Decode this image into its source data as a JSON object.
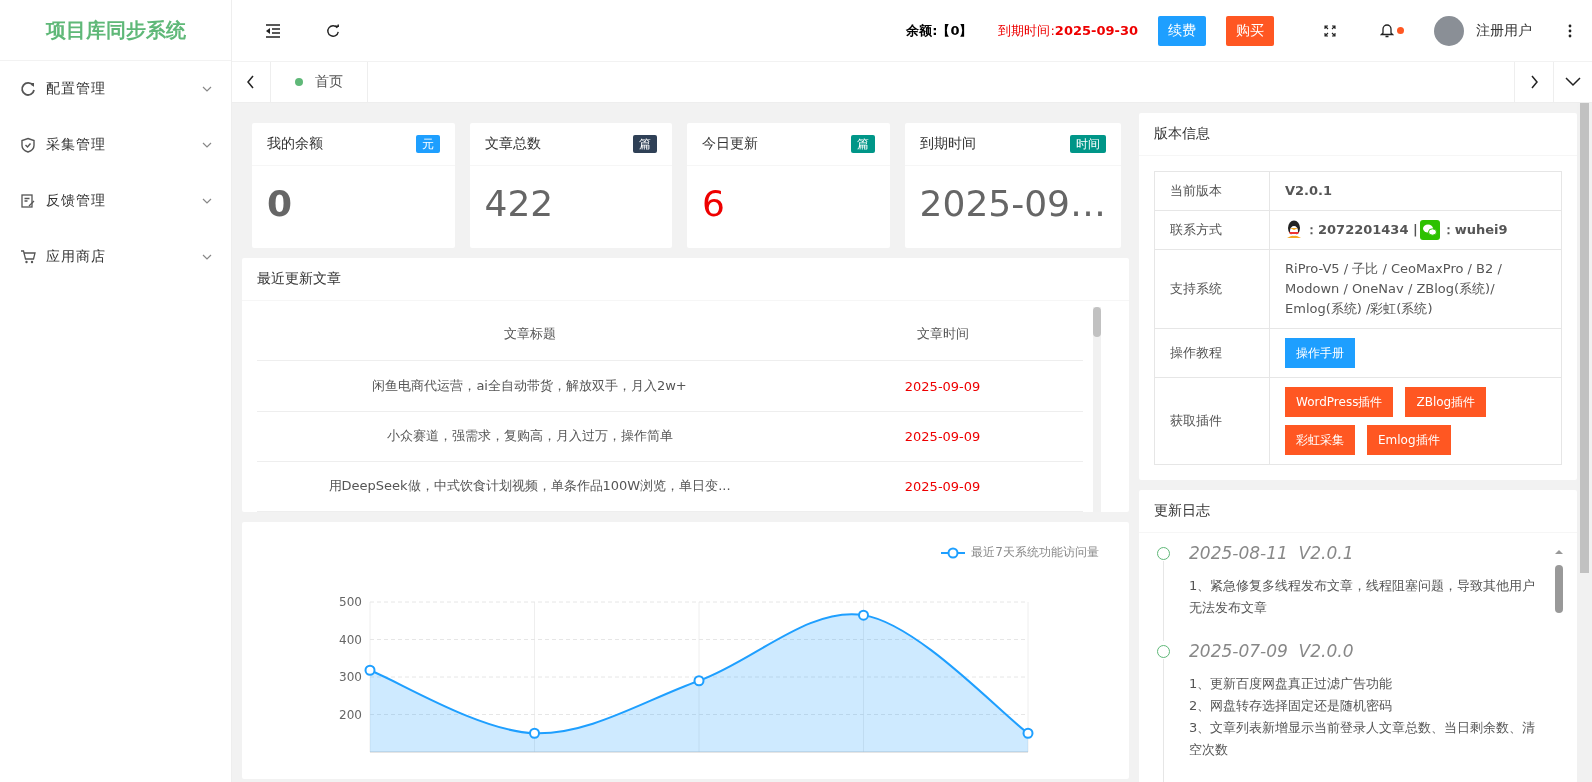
{
  "header": {
    "logo": "项目库同步系统",
    "balance": "余额:【0】",
    "expiry_label": "到期时间:",
    "expiry_value": "2025-09-30",
    "renew_button": "续费",
    "buy_button": "购买",
    "notification_dot": true,
    "username": "注册用户"
  },
  "sidebar": {
    "items": [
      {
        "label": "配置管理",
        "kind": "refresh",
        "expanded": false
      },
      {
        "label": "采集管理",
        "kind": "shield",
        "expanded": false
      },
      {
        "label": "反馈管理",
        "kind": "feedback",
        "expanded": false
      },
      {
        "label": "应用商店",
        "kind": "cart",
        "expanded": false
      }
    ]
  },
  "tabs": [
    {
      "label": "首页",
      "selected": true
    }
  ],
  "stat_cards": [
    {
      "title": "我的余额",
      "badge": "元",
      "color": "#1e9fff",
      "value": "0",
      "kind": "bold"
    },
    {
      "title": "文章总数",
      "badge": "篇",
      "color": "#2f4056",
      "value": "422",
      "kind": "plain"
    },
    {
      "title": "今日更新",
      "badge": "篇",
      "color": "#009688",
      "value": "6",
      "kind": "alert"
    },
    {
      "title": "到期时间",
      "badge": "时间",
      "color": "#009688",
      "value": "2025-09…",
      "kind": "plain"
    }
  ],
  "recent_articles": {
    "title": "最近更新文章",
    "columns": [
      "文章标题",
      "文章时间"
    ],
    "rows": [
      {
        "title": "闲鱼电商代运营，ai全自动带货，解放双手，月入2w+",
        "time": "2025-09-09"
      },
      {
        "title": "小众赛道，强需求，复购高，月入过万，操作简单",
        "time": "2025-09-09"
      },
      {
        "title": "用DeepSeek做，中式饮食计划视频，单条作品100W浏览，单日变...",
        "time": "2025-09-09"
      }
    ]
  },
  "visits_chart": {
    "chart_data": {
      "type": "area",
      "ylim": [
        100,
        500
      ],
      "grid": true,
      "yticks": [
        200,
        300,
        400,
        500
      ],
      "series": [
        {
          "name": "最近7天系统功能访问量",
          "color": "#1e9fff",
          "values": [
            318,
            150,
            290,
            465,
            150
          ]
        }
      ]
    }
  },
  "version_info": {
    "title": "版本信息",
    "rows": [
      {
        "label": "当前版本",
        "kind": "text",
        "value": "V2.0.1",
        "bold": true
      },
      {
        "label": "联系方式",
        "kind": "contact",
        "qq": "：2072201434 |",
        "wechat": "：wuhei9"
      },
      {
        "label": "支持系统",
        "kind": "text",
        "value": "RiPro-V5 / 子比 / CeoMaxPro / B2 / Modown / OneNav / ZBlog(系统)/ Emlog(系统) /彩虹(系统)",
        "bold": false
      },
      {
        "label": "操作教程",
        "kind": "buttons",
        "buttons": [
          {
            "label": "操作手册",
            "color": "#1e9fff"
          }
        ]
      },
      {
        "label": "获取插件",
        "kind": "buttons",
        "buttons": [
          {
            "label": "WordPress插件",
            "color": "#ff5722"
          },
          {
            "label": "ZBlog插件",
            "color": "#ff5722"
          },
          {
            "label": "彩虹采集",
            "color": "#ff5722"
          },
          {
            "label": "Emlog插件",
            "color": "#ff5722"
          }
        ]
      }
    ]
  },
  "changelog": {
    "title": "更新日志",
    "entries": [
      {
        "heading": "2025-08-11  V2.0.1",
        "lines": [
          "1、紧急修复多线程发布文章，线程阻塞问题，导致其他用户无法发布文章"
        ]
      },
      {
        "heading": "2025-07-09  V2.0.0",
        "lines": [
          "1、更新百度网盘真正过滤广告功能",
          "2、网盘转存选择固定还是随机密码",
          "3、文章列表新增显示当前登录人文章总数、当日剩余数、清空次数"
        ]
      }
    ]
  }
}
